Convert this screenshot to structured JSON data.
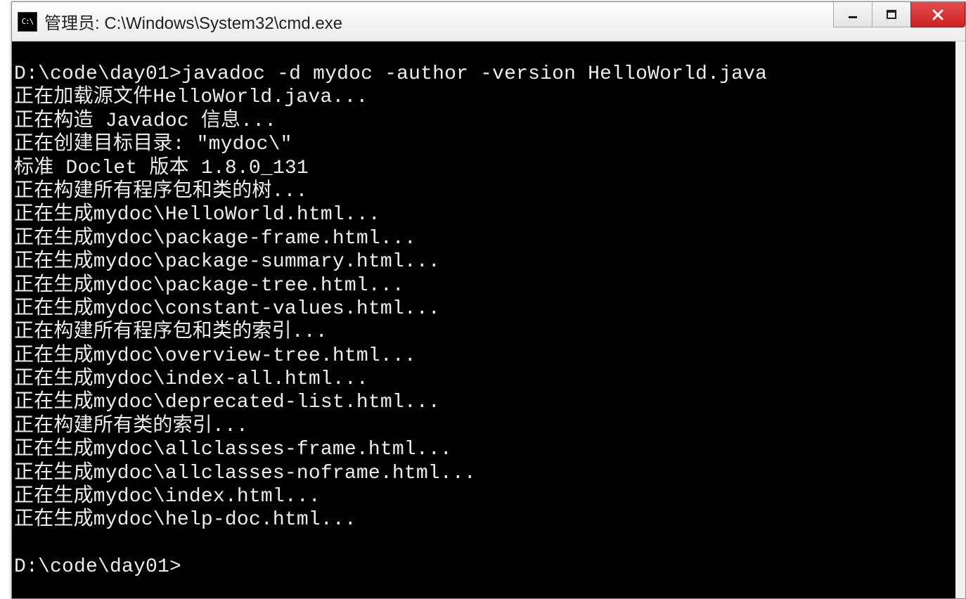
{
  "titlebar": {
    "icon_label": "C:\\",
    "title": "管理员: C:\\Windows\\System32\\cmd.exe"
  },
  "console": {
    "prompt1_path": "D:\\code\\day01>",
    "command": "javadoc -d mydoc -author -version HelloWorld.java",
    "lines": [
      "正在加载源文件HelloWorld.java...",
      "正在构造 Javadoc 信息...",
      "正在创建目标目录: \"mydoc\\\"",
      "标准 Doclet 版本 1.8.0_131",
      "正在构建所有程序包和类的树...",
      "正在生成mydoc\\HelloWorld.html...",
      "正在生成mydoc\\package-frame.html...",
      "正在生成mydoc\\package-summary.html...",
      "正在生成mydoc\\package-tree.html...",
      "正在生成mydoc\\constant-values.html...",
      "正在构建所有程序包和类的索引...",
      "正在生成mydoc\\overview-tree.html...",
      "正在生成mydoc\\index-all.html...",
      "正在生成mydoc\\deprecated-list.html...",
      "正在构建所有类的索引...",
      "正在生成mydoc\\allclasses-frame.html...",
      "正在生成mydoc\\allclasses-noframe.html...",
      "正在生成mydoc\\index.html...",
      "正在生成mydoc\\help-doc.html..."
    ],
    "prompt2_path": "D:\\code\\day01>"
  }
}
